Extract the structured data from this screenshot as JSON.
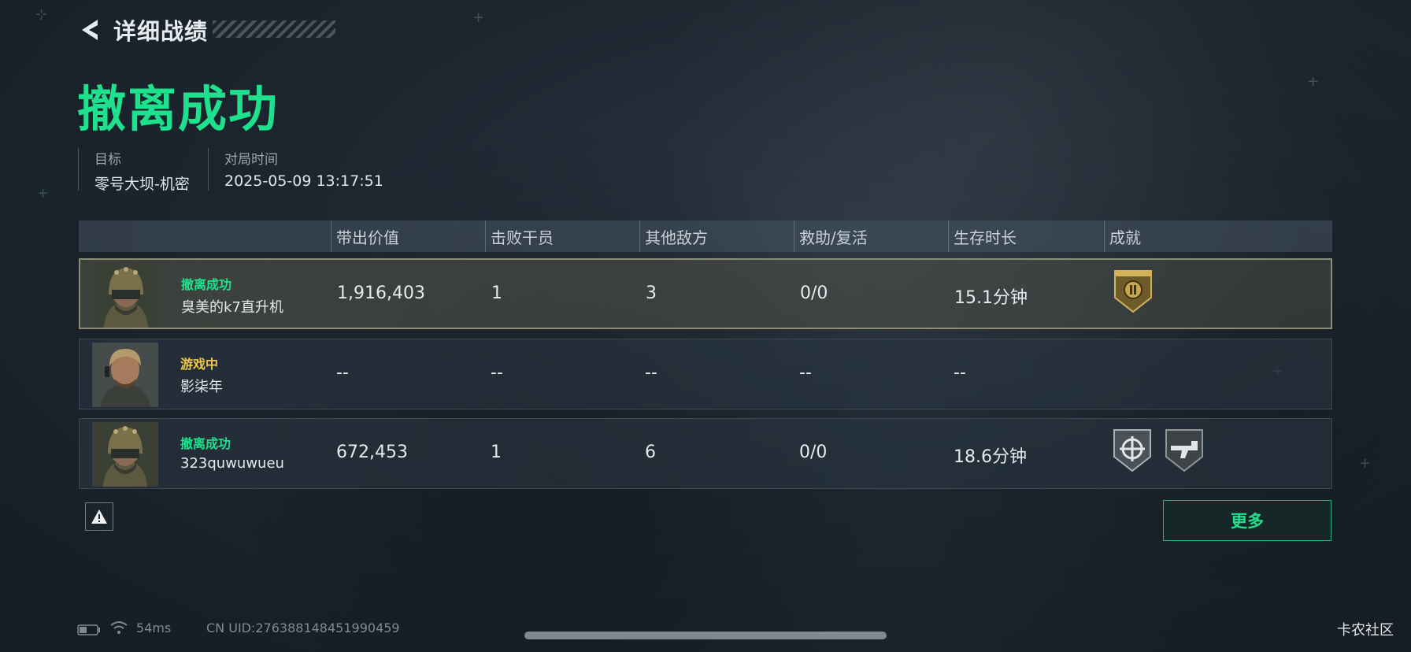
{
  "header": {
    "title": "详细战绩",
    "back_icon": "back-arrow-icon"
  },
  "result": {
    "title": "撤离成功",
    "color": "#1fe08c"
  },
  "meta": {
    "target_label": "目标",
    "target_value": "零号大坝-机密",
    "time_label": "对局时间",
    "time_value": "2025-05-09 13:17:51"
  },
  "table": {
    "columns": [
      "带出价值",
      "击败干员",
      "其他敌方",
      "救助/复活",
      "生存时长",
      "成就"
    ],
    "rows": [
      {
        "status": "撤离成功",
        "status_color": "#1fe08c",
        "name": "臭美的k7直升机",
        "value": "1,916,403",
        "kills": "1",
        "others": "3",
        "assist": "0/0",
        "time": "15.1分钟",
        "badges": [
          "gold-shield-badge-icon"
        ]
      },
      {
        "status": "游戏中",
        "status_color": "#f2c84b",
        "name": "影柒年",
        "value": "--",
        "kills": "--",
        "others": "--",
        "assist": "--",
        "time": "--",
        "badges": []
      },
      {
        "status": "撤离成功",
        "status_color": "#1fe08c",
        "name": "323quwuwueu",
        "value": "672,453",
        "kills": "1",
        "others": "6",
        "assist": "0/0",
        "time": "18.6分钟",
        "badges": [
          "crosshair-badge-icon",
          "gun-badge-icon"
        ]
      }
    ]
  },
  "buttons": {
    "more": "更多",
    "warning_icon": "warning-icon"
  },
  "footer": {
    "ping": "54ms",
    "uid": "CN UID:276388148451990459",
    "watermark": "卡农社区",
    "battery_icon": "battery-icon",
    "wifi_icon": "wifi-icon"
  }
}
